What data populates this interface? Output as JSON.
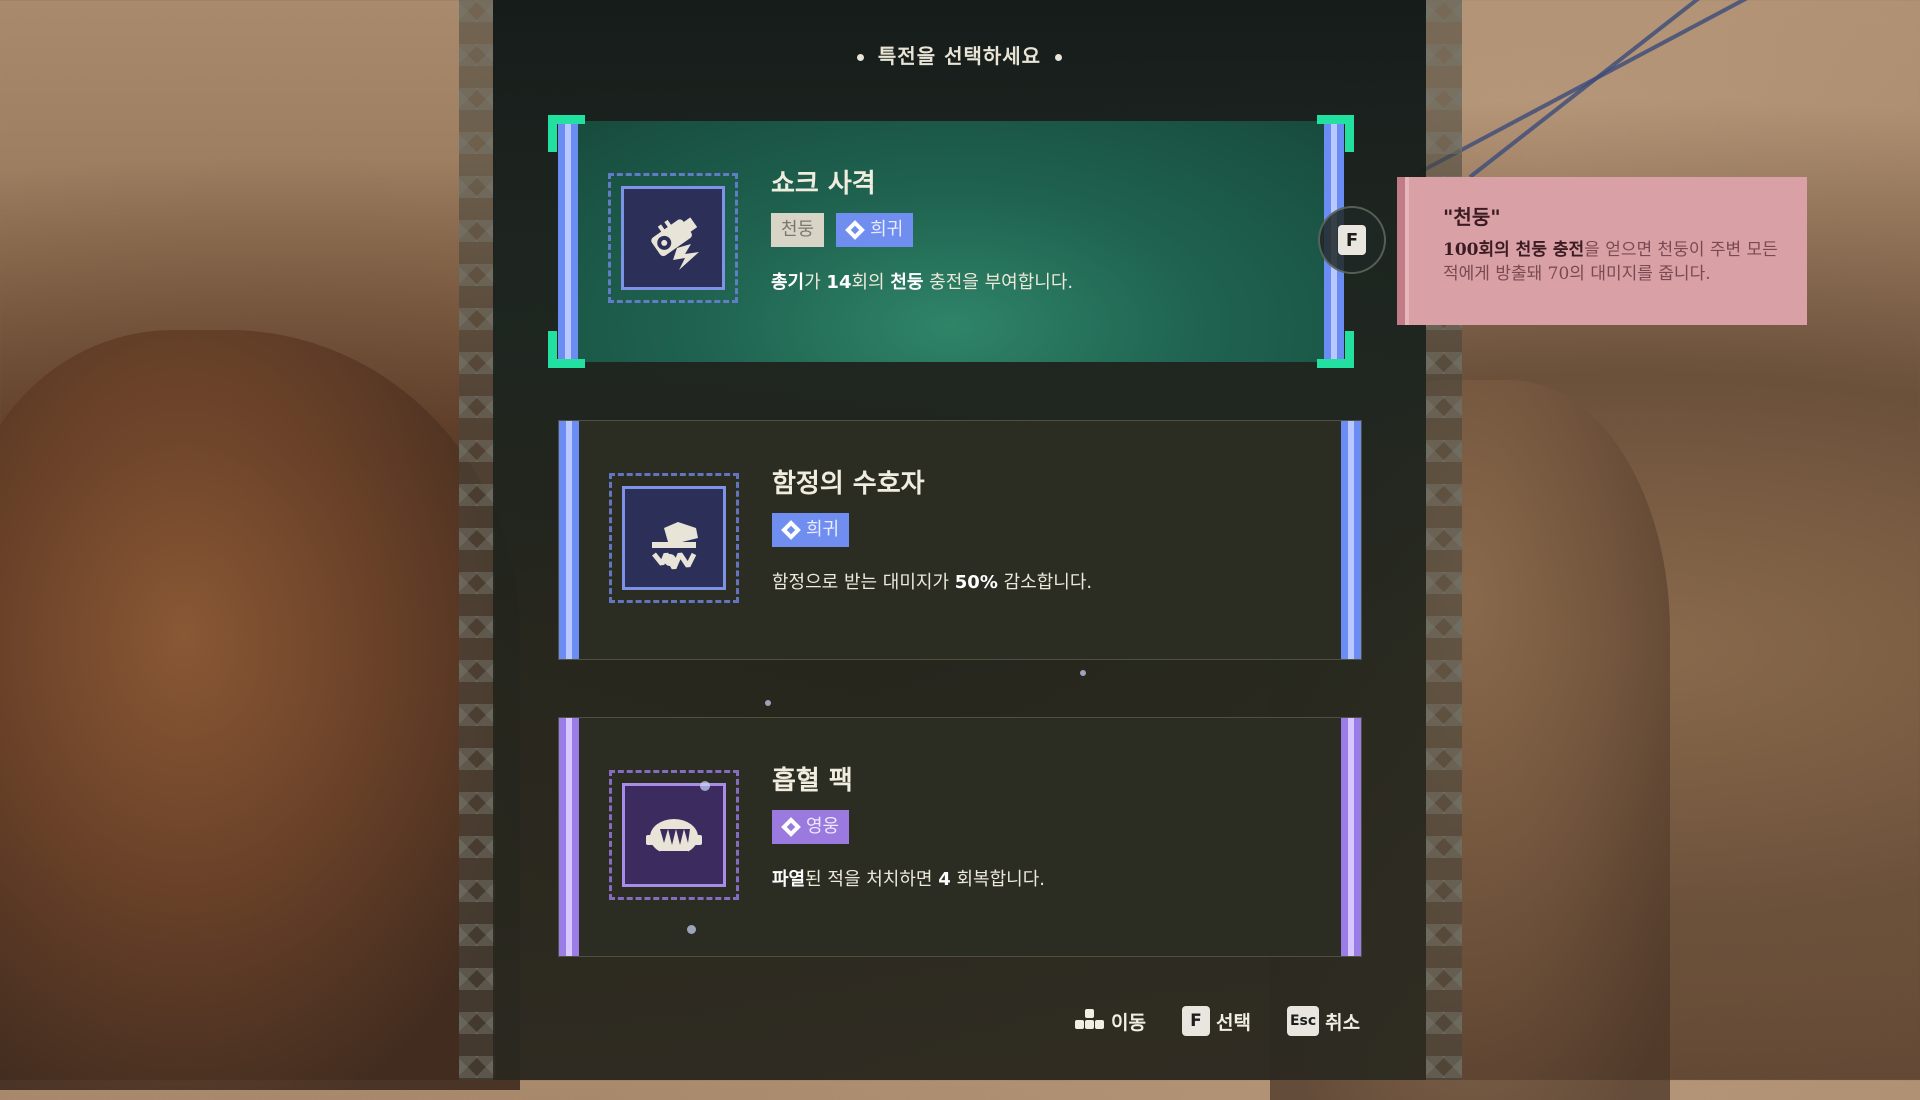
{
  "header": {
    "title": "특전을 선택하세요"
  },
  "cards": [
    {
      "title": "쇼크 사격",
      "tags": [
        {
          "label": "천둥",
          "style": "grey"
        },
        {
          "label": "희귀",
          "style": "blue",
          "icon": "rarity-diamond-icon"
        }
      ],
      "desc_parts": [
        "총기",
        "가 ",
        "14",
        "회의 ",
        "천둥",
        " 충전을 부여합니다."
      ],
      "icon": "shock-shot-icon",
      "selected": true
    },
    {
      "title": "함정의 수호자",
      "tags": [
        {
          "label": "희귀",
          "style": "blue",
          "icon": "rarity-diamond-icon"
        }
      ],
      "desc_parts": [
        "함정으로 받는 대미지가 ",
        "50%",
        " 감소합니다."
      ],
      "icon": "trap-guardian-icon",
      "selected": false
    },
    {
      "title": "흡혈 팩",
      "tags": [
        {
          "label": "영웅",
          "style": "purple",
          "icon": "rarity-diamond-icon"
        }
      ],
      "desc_parts": [
        "파열",
        "된 적을 처치하면 ",
        "4",
        " 회복합니다."
      ],
      "icon": "vampire-pack-icon",
      "selected": false
    }
  ],
  "select_key": "F",
  "tooltip": {
    "title": "\"천둥\"",
    "body_bold": "100회의 천둥 충전",
    "body_rest": "을 얻으면 천둥이 주변 모든 적에게 방출돼 70의 대미지를 줍니다."
  },
  "hints": {
    "move_label": "이동",
    "select_key": "F",
    "select_label": "선택",
    "cancel_key": "Esc",
    "cancel_label": "취소"
  },
  "colors": {
    "rare_blue": "#6f8ef0",
    "epic_purple": "#9b7ae0",
    "selected_green": "#1f6350",
    "tooltip_pink": "#d9a0a6"
  }
}
